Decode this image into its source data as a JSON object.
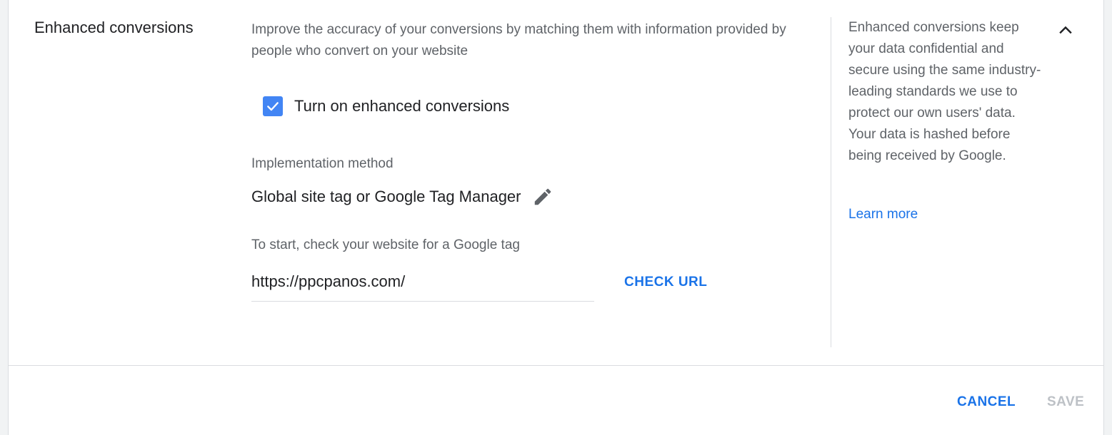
{
  "section": {
    "title": "Enhanced conversions",
    "description": "Improve the accuracy of your conversions by matching them with information provided by people who convert on your website"
  },
  "checkbox": {
    "label": "Turn on enhanced conversions",
    "checked": true,
    "color": "#4285f4"
  },
  "implementation": {
    "label": "Implementation method",
    "value": "Global site tag or Google Tag Manager",
    "edit_icon": "pencil-icon"
  },
  "url_check": {
    "prompt": "To start, check your website for a Google tag",
    "url_value": "https://ppcpanos.com/",
    "check_button": "CHECK URL"
  },
  "help_panel": {
    "text": "Enhanced conversions keep your data confidential and secure using the same industry-leading standards we use to protect our own users' data. Your data is hashed before being received by Google.",
    "learn_more": "Learn more",
    "collapse_icon": "chevron-up-icon"
  },
  "footer": {
    "cancel_label": "CANCEL",
    "save_label": "SAVE",
    "save_enabled": false
  },
  "colors": {
    "accent": "#1a73e8",
    "disabled": "#bdc1c6",
    "secondary_text": "#5f6368"
  }
}
